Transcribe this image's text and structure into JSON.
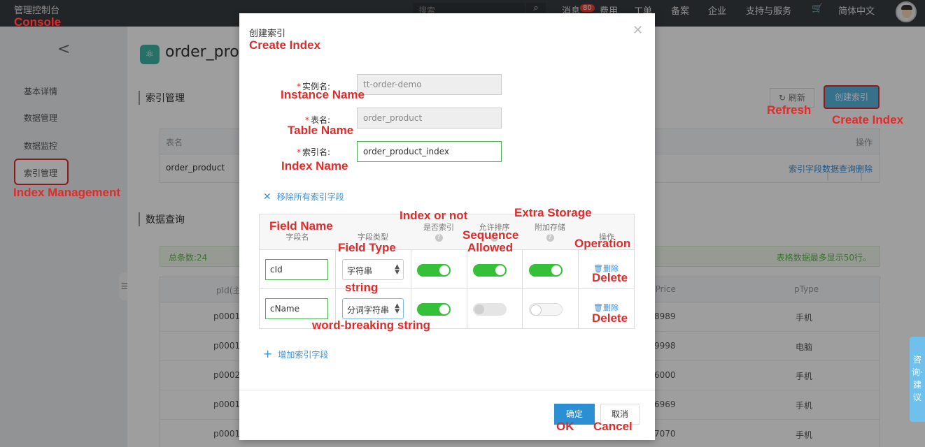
{
  "topnav": {
    "console": "管理控制台",
    "search_placeholder": "搜索",
    "messages": "消息",
    "message_count": "80",
    "items": [
      "费用",
      "工单",
      "备案",
      "企业",
      "支持与服务",
      "简体中文"
    ]
  },
  "sidebar": {
    "items": [
      "基本详情",
      "数据管理",
      "数据监控",
      "索引管理"
    ]
  },
  "main": {
    "title": "order_pro",
    "index_section": "索引管理",
    "refresh": "刷新",
    "create_index": "创建索引",
    "index_table": {
      "col_table": "表名",
      "col_ops": "操作",
      "row_table": "order_product",
      "ops": [
        "索引字段",
        "数据查询",
        "删除"
      ]
    },
    "query_section": "数据查询",
    "total": "总条数:24",
    "max_rows": "表格数据最多显示50行。",
    "data_table": {
      "headers": [
        "pId(主",
        "pPrice",
        "pType"
      ],
      "rows": [
        {
          "id": "p0001",
          "price": "8989",
          "type": "手机"
        },
        {
          "id": "p0001",
          "price": "9998",
          "type": "电脑"
        },
        {
          "id": "p0002",
          "price": "6000",
          "type": "手机"
        },
        {
          "id": "p0001",
          "price": "6969",
          "type": "手机"
        },
        {
          "id": "p0001",
          "price": "7070",
          "type": "手机"
        }
      ]
    },
    "side_float": "咨询·建议"
  },
  "modal": {
    "title": "创建索引",
    "instance_label": "实例名:",
    "instance_value": "tt-order-demo",
    "table_label": "表名:",
    "table_value": "order_product",
    "index_label": "索引名:",
    "index_value": "order_product_index",
    "remove_all": "移除所有索引字段",
    "fields_table": {
      "col_name": "字段名",
      "col_type": "字段类型",
      "col_indexed": "是否索引",
      "col_sort": "允许排序",
      "col_store": "附加存储",
      "col_ops": "操作",
      "rows": [
        {
          "name": "cId",
          "type": "字符串",
          "indexed": true,
          "sortable": true,
          "stored": true,
          "delete": "删除"
        },
        {
          "name": "cName",
          "type": "分词字符串",
          "indexed": true,
          "sortable": false,
          "stored": false,
          "delete": "删除"
        }
      ]
    },
    "add_field": "增加索引字段",
    "ok": "确定",
    "cancel": "取消"
  },
  "annotations": {
    "console": "Console",
    "create_index_title": "Create Index",
    "instance_name": "Instance Name",
    "table_name": "Table Name",
    "index_name": "Index Name",
    "index_management": "Index Management",
    "refresh": "Refresh",
    "create_index_btn": "Create Index",
    "field_name": "Field Name",
    "field_type": "Field Type",
    "index_or_not": "Index or not",
    "sequence": "Sequence",
    "allowed": "Allowed",
    "extra_storage": "Extra Storage",
    "operation": "Operation",
    "delete1": "Delete",
    "delete2": "Delete",
    "string": "string",
    "word_breaking": "word-breaking string",
    "ok": "OK",
    "cancel": "Cancel"
  }
}
